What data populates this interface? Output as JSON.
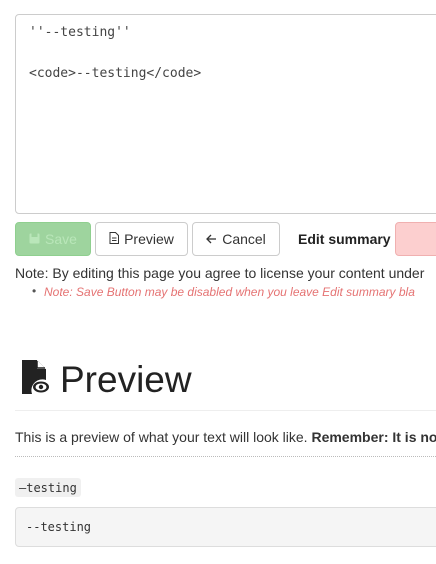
{
  "editor": {
    "line1": "''--testing''",
    "line2": "<code>--testing</code>"
  },
  "toolbar": {
    "save_label": "Save",
    "preview_label": "Preview",
    "cancel_label": "Cancel",
    "summary_label": "Edit summary"
  },
  "colors": {
    "save_bg": "#9ed49e",
    "summary_input_bg": "#fccfcf",
    "note_italic": "#e57373"
  },
  "notes": {
    "license": "Note: By editing this page you agree to license your content under",
    "disabled": "Note: Save Button may be disabled when you leave Edit summary bla"
  },
  "preview": {
    "title": "Preview",
    "intro": "This is a preview of what your text will look like. ",
    "intro_bold": "Remember: It is no",
    "inline_code": "–testing",
    "code_block": "--testing"
  }
}
